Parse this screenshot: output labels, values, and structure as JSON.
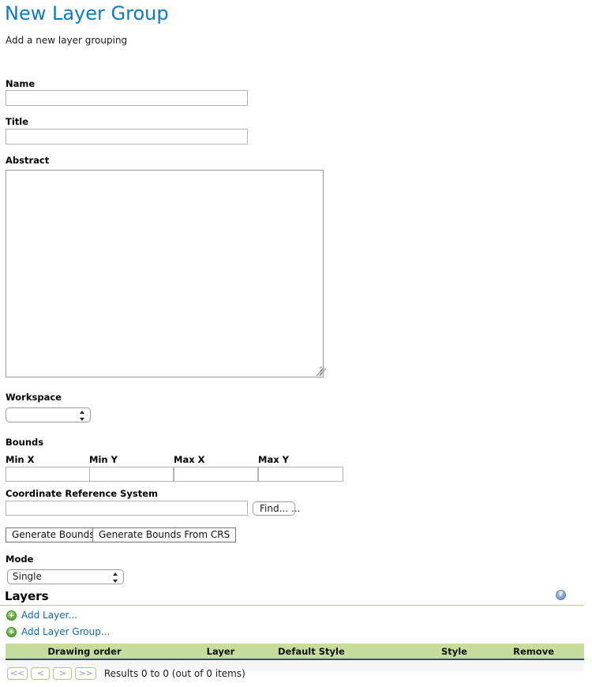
{
  "header": {
    "title": "New Layer Group",
    "subtitle": "Add a new layer grouping"
  },
  "form": {
    "name": {
      "label": "Name",
      "value": "",
      "placeholder": ""
    },
    "title": {
      "label": "Title",
      "value": "",
      "placeholder": ""
    },
    "abstract": {
      "label": "Abstract",
      "value": "",
      "placeholder": ""
    },
    "workspace": {
      "label": "Workspace",
      "value": "",
      "options": [
        ""
      ]
    },
    "bounds": {
      "label": "Bounds",
      "fields": [
        {
          "label": "Min X",
          "value": ""
        },
        {
          "label": "Min Y",
          "value": ""
        },
        {
          "label": "Max X",
          "value": ""
        },
        {
          "label": "Max Y",
          "value": ""
        }
      ]
    },
    "crs": {
      "label": "Coordinate Reference System",
      "value": "",
      "find_label": "Find...",
      "ellipsis": "..."
    },
    "generate_bounds_label": "Generate Bounds",
    "generate_bounds_from_crs_label": "Generate Bounds From CRS",
    "mode": {
      "label": "Mode",
      "value": "Single",
      "options": [
        "Single"
      ]
    }
  },
  "layers": {
    "heading": "Layers",
    "help_icon": "help-icon",
    "help_glyph": "?",
    "add_layer_label": "Add Layer...",
    "add_layer_group_label": "Add Layer Group...",
    "add_icon": "plus-circle-icon",
    "columns": [
      "Drawing order",
      "Layer",
      "Default Style",
      "Style",
      "Remove"
    ],
    "rows": [],
    "pagination": {
      "first_label": "<<",
      "prev_label": "<",
      "next_label": ">",
      "last_label": ">>",
      "status": "Results 0 to 0 (out of 0 items)"
    }
  },
  "colors": {
    "title_blue": "#0d7ac4",
    "link_blue": "#1668a8",
    "table_header_green": "#c6dd9d",
    "rule_green": "#b5d17f",
    "table_underline_blue": "#1d5b88"
  }
}
